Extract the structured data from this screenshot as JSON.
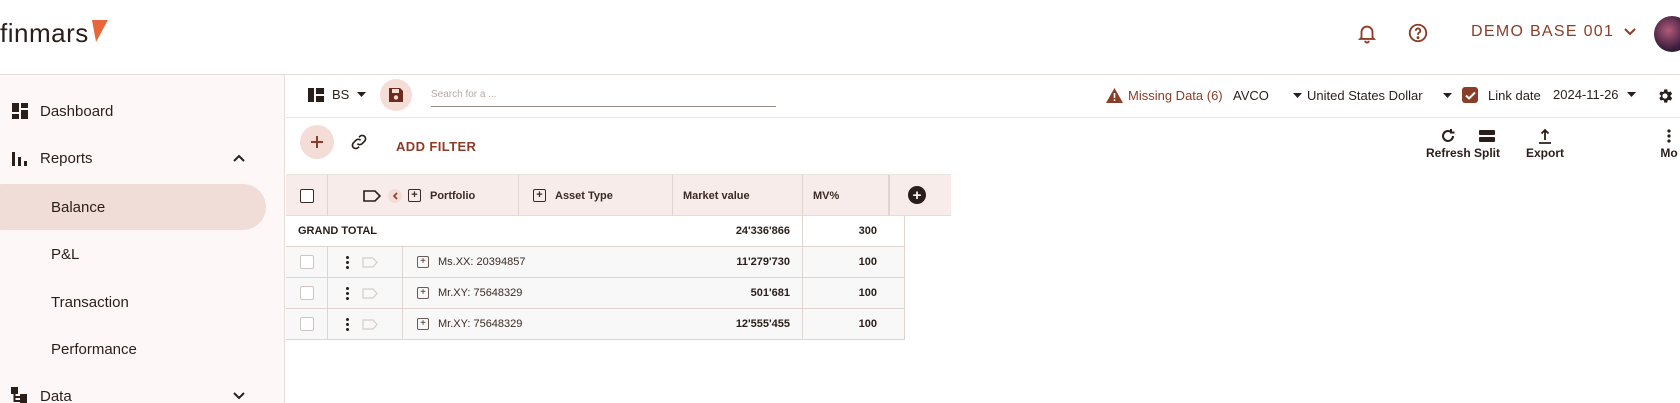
{
  "header": {
    "logo_text": "finmars",
    "workspace": "DEMO BASE 001",
    "icons": [
      "bell-icon",
      "help-icon",
      "chevron-down-icon"
    ],
    "accent_color": "#8b3d28",
    "logo_color": "#e8673a"
  },
  "sidebar": {
    "items": [
      {
        "label": "Dashboard",
        "icon": "dashboard-icon"
      },
      {
        "label": "Reports",
        "icon": "bar-chart-icon",
        "expanded": true
      },
      {
        "label": "Data",
        "icon": "hierarchy-icon",
        "expanded": false
      }
    ],
    "report_items": [
      {
        "label": "Balance",
        "active": true
      },
      {
        "label": "P&L"
      },
      {
        "label": "Transaction"
      },
      {
        "label": "Performance"
      }
    ]
  },
  "toolbar": {
    "layout_label": "BS",
    "search_placeholder": "Search for a ...",
    "missing_data": "Missing Data (6)",
    "cost_method": "AVCO",
    "currency": "United States Dollar",
    "link_date_label": "Link date",
    "link_date_checked": true,
    "date": "2024-11-26",
    "add_filter": "ADD FILTER",
    "tools": [
      {
        "label": "Refresh",
        "icon": "refresh-icon"
      },
      {
        "label": "Split",
        "icon": "split-icon"
      },
      {
        "label": "Export",
        "icon": "export-icon"
      },
      {
        "label": "Mo",
        "icon": "more-icon"
      }
    ]
  },
  "grid": {
    "columns": [
      "Portfolio",
      "Asset Type",
      "Market value",
      "MV%"
    ],
    "grand_total": {
      "label": "GRAND TOTAL",
      "market_value": "24'336'866",
      "mv_pct": "300"
    },
    "rows": [
      {
        "portfolio": "Ms.XX: 20394857",
        "market_value": "11'279'730",
        "mv_pct": "100"
      },
      {
        "portfolio": "Mr.XY: 75648329",
        "market_value": "501'681",
        "mv_pct": "100"
      },
      {
        "portfolio": "Mr.XY: 75648329",
        "market_value": "12'555'455",
        "mv_pct": "100"
      }
    ]
  }
}
